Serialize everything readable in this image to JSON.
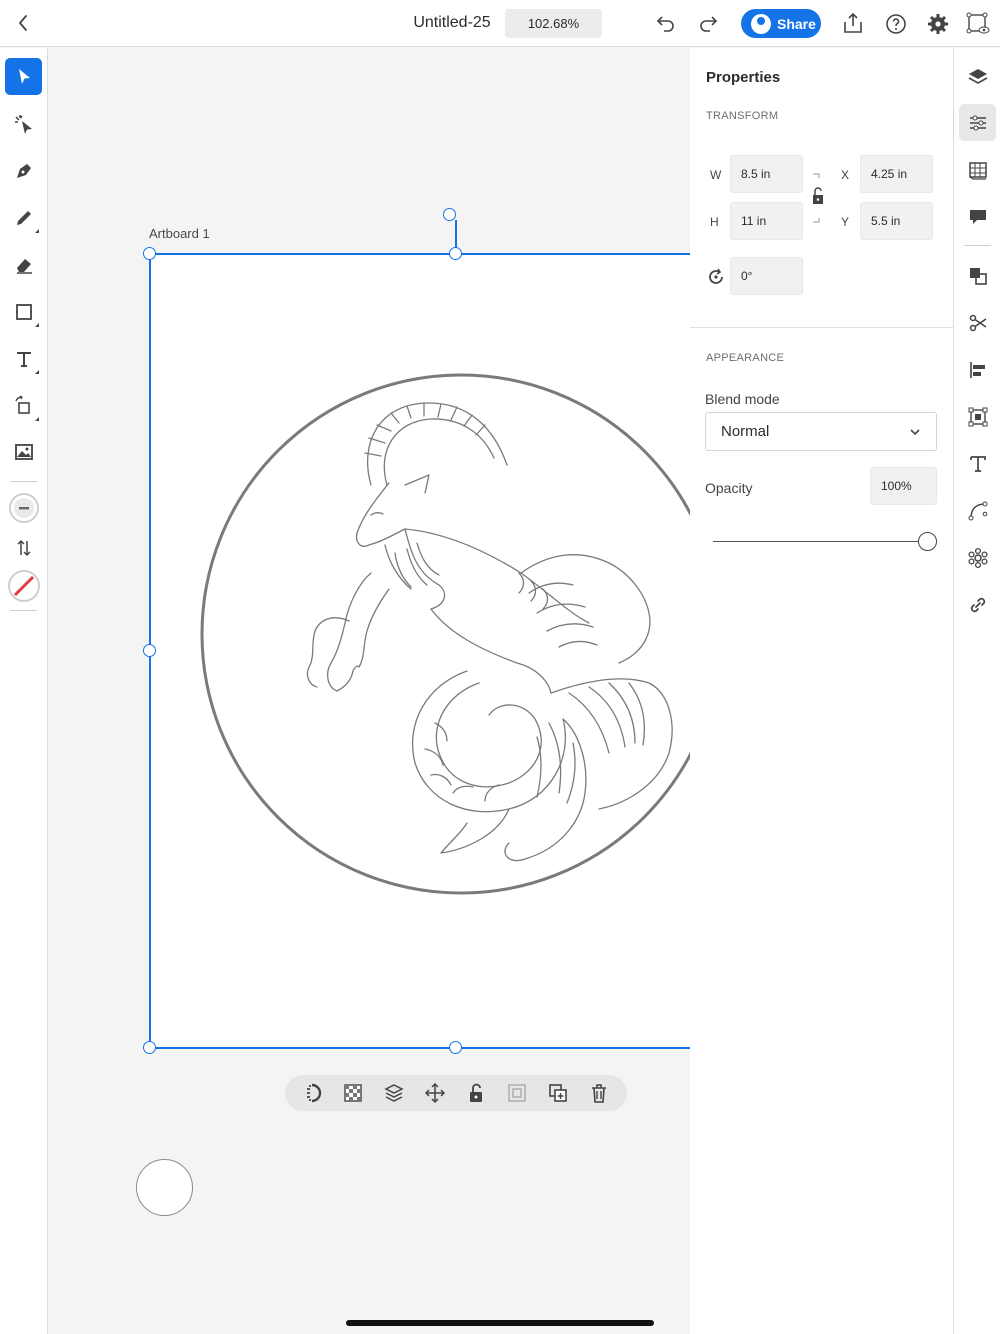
{
  "topbar": {
    "title": "Untitled-25",
    "zoom": "102.68%",
    "share_label": "Share",
    "accent": "#1473e6"
  },
  "left_tools": [
    {
      "name": "selection-tool",
      "icon": "arrow-pointer-icon",
      "active": true
    },
    {
      "name": "direct-selection-tool",
      "icon": "sparkle-pointer-icon"
    },
    {
      "name": "pen-tool",
      "icon": "pen-nib-icon"
    },
    {
      "name": "pencil-tool",
      "icon": "pencil-icon"
    },
    {
      "name": "eraser-tool",
      "icon": "eraser-icon"
    },
    {
      "name": "rectangle-tool",
      "icon": "square-icon"
    },
    {
      "name": "type-tool",
      "icon": "type-icon"
    },
    {
      "name": "crop-tool",
      "icon": "crop-rotate-icon"
    },
    {
      "name": "place-image-tool",
      "icon": "image-icon"
    },
    {
      "name": "fill-swatch",
      "icon": "minus-circle-icon"
    },
    {
      "name": "swap-fill-stroke",
      "icon": "swap-arrows-icon"
    },
    {
      "name": "stroke-swatch",
      "icon": "none-swatch-icon"
    }
  ],
  "canvas": {
    "artboard_label": "Artboard 1",
    "artwork": "capricorn-sea-goat-sketch"
  },
  "context_bar": [
    "clipping-mask-icon",
    "transparency-icon",
    "arrange-icon",
    "move-icon",
    "unlock-icon",
    "group-icon",
    "duplicate-icon",
    "trash-icon"
  ],
  "properties": {
    "title": "Properties",
    "transform": {
      "section_label": "TRANSFORM",
      "w_label": "W",
      "w_value": "8.5 in",
      "h_label": "H",
      "h_value": "11 in",
      "x_label": "X",
      "x_value": "4.25 in",
      "y_label": "Y",
      "y_value": "5.5 in",
      "rotation_value": "0°"
    },
    "appearance": {
      "section_label": "APPEARANCE",
      "blend_label": "Blend mode",
      "blend_value": "Normal",
      "opacity_label": "Opacity",
      "opacity_value": "100%",
      "opacity_level": 1.0
    }
  },
  "right_rail": [
    "layers-icon",
    "properties-icon",
    "libraries-icon",
    "comments-icon",
    "pathfinder-icon",
    "scissors-icon",
    "align-icon",
    "transform-icon",
    "text-icon",
    "curve-icon",
    "symbol-icon",
    "link-icon"
  ]
}
